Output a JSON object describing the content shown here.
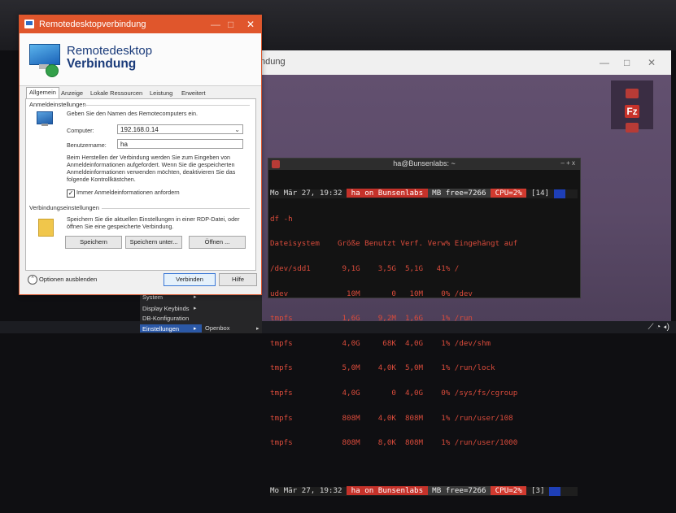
{
  "dialog": {
    "title": "Remotedesktopverbindung",
    "header_line1": "Remotedesktop",
    "header_line2": "Verbindung",
    "tabs": [
      "Allgemein",
      "Anzeige",
      "Lokale Ressourcen",
      "Leistung",
      "Erweitert"
    ],
    "login_group": "Anmeldeinstellungen",
    "login_hint": "Geben Sie den Namen des Remotecomputers ein.",
    "computer_label": "Computer:",
    "computer_value": "192.168.0.14",
    "user_label": "Benutzername:",
    "user_value": "ha",
    "info_text": "Beim Herstellen der Verbindung werden Sie zum Eingeben von Anmeldeinformationen aufgefordert. Wenn Sie die gespeicherten Anmeldeinformationen verwenden möchten, deaktivieren Sie das folgende Kontrollkästchen.",
    "always_ask_label": "Immer Anmeldeinformationen anfordern",
    "always_ask_checked": true,
    "conn_group": "Verbindungseinstellungen",
    "conn_text": "Speichern Sie die aktuellen Einstellungen in einer RDP-Datei, oder öffnen Sie eine gespeicherte Verbindung.",
    "save_label": "Speichern",
    "save_as_label": "Speichern unter...",
    "open_label": "Öffnen ...",
    "options_label": "Optionen ausblenden",
    "connect_label": "Verbinden",
    "help_label": "Hilfe",
    "wbtn_min": "—",
    "wbtn_max": "□",
    "wbtn_close": "✕"
  },
  "bg_window": {
    "title_fragment": "ndung",
    "min": "—",
    "max": "□",
    "close": "✕"
  },
  "terminal": {
    "title": "ha@Bunsenlabs: ~",
    "controls": "–  +  x",
    "status1": {
      "date": "Mo Mär 27, 19:32",
      "host": " ha on Bunsenlabs ",
      "mem": " MB free=7266 ",
      "cpu": " CPU=2% ",
      "win": "[14]"
    },
    "cmd": "df -h",
    "header": "Dateisystem    Größe Benutzt Verf. Verw% Eingehängt auf",
    "rows": [
      "/dev/sdd1       9,1G    3,5G  5,1G   41% /",
      "udev             10M       0   10M    0% /dev",
      "tmpfs           1,6G    9,2M  1,6G    1% /run",
      "tmpfs           4,0G     68K  4,0G    1% /dev/shm",
      "tmpfs           5,0M    4,0K  5,0M    1% /run/lock",
      "tmpfs           4,0G       0  4,0G    0% /sys/fs/cgroup",
      "tmpfs           808M    4,0K  808M    1% /run/user/108",
      "tmpfs           808M    8,0K  808M    1% /run/user/1000"
    ],
    "status2": {
      "date": "Mo Mär 27, 19:32",
      "host": " ha on Bunsenlabs ",
      "mem": " MB free=7266 ",
      "cpu": " CPU=2% ",
      "win": "[3]"
    }
  },
  "menu": {
    "items": [
      "System",
      "Display Keybinds",
      "DB-Konfiguration",
      "Einstellungen"
    ],
    "arrow": "▸",
    "submenu": "Openbox"
  },
  "side_icons": {
    "fz_label": "Fz"
  },
  "colors": {
    "accent_orange": "#e0562c",
    "terminal_red": "#d94b3b",
    "bg_purple": "#5b4a6b"
  }
}
